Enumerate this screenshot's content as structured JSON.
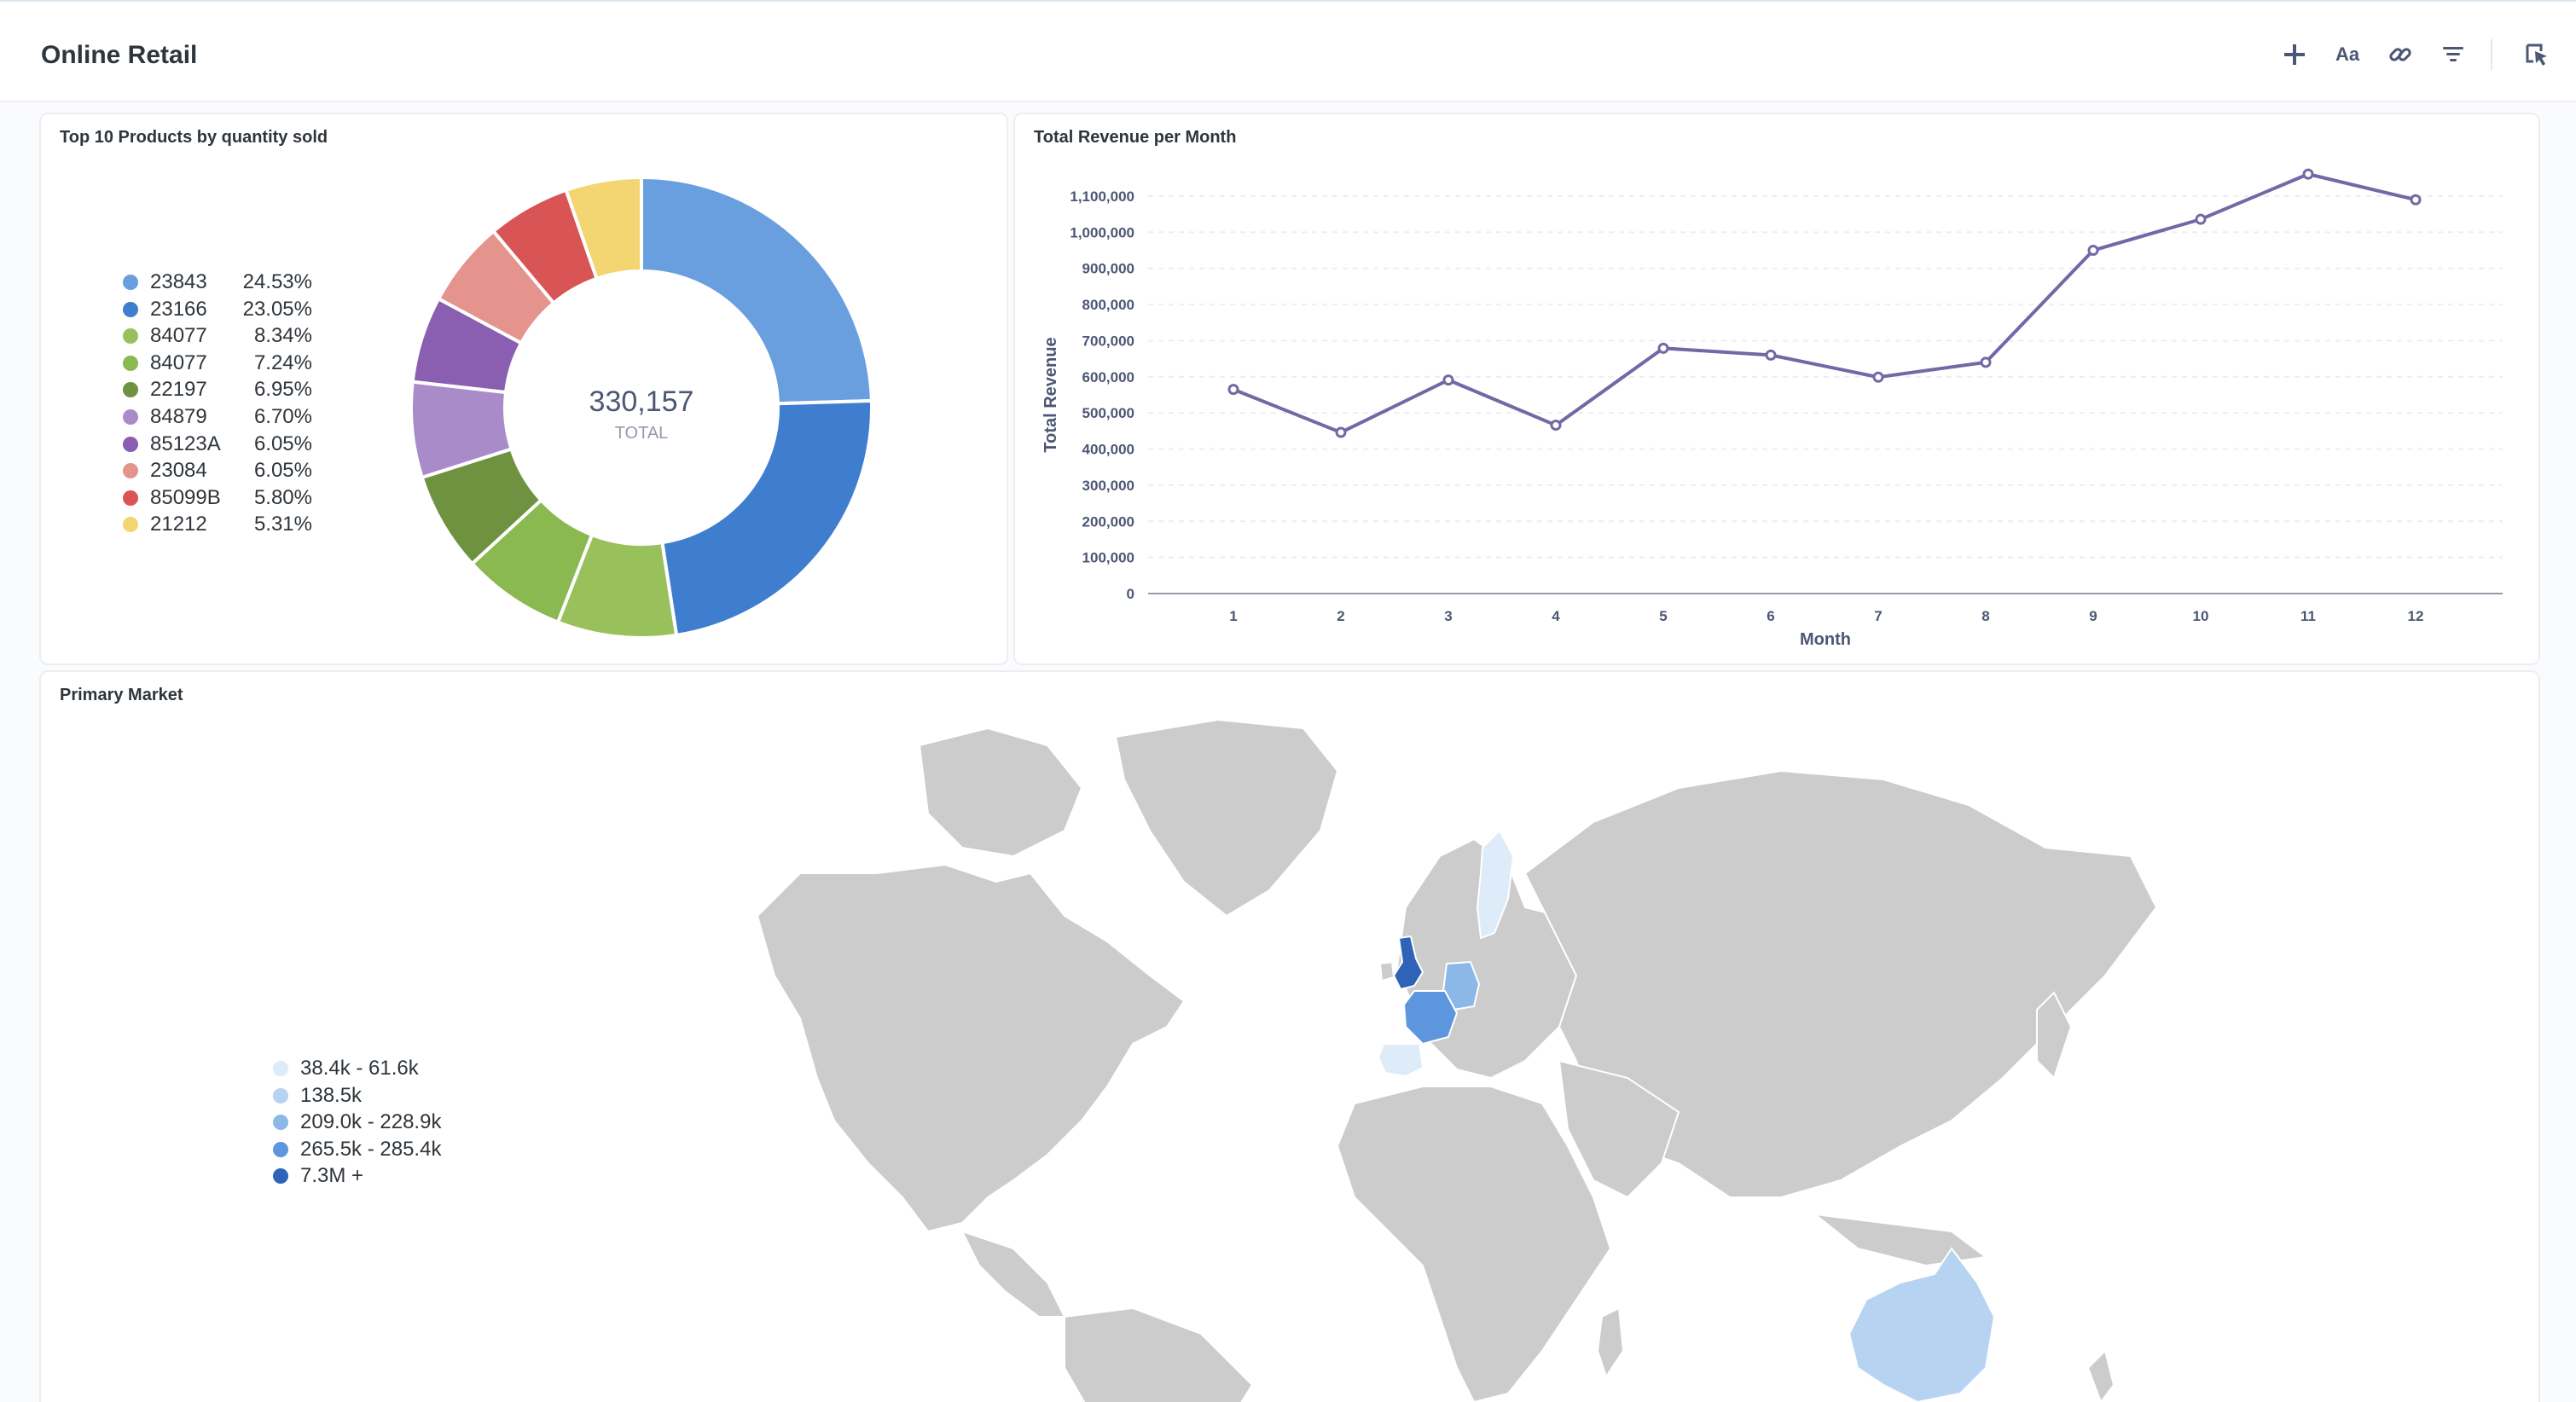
{
  "header": {
    "title": "Online Retail",
    "tools": [
      {
        "icon": "plus-icon",
        "label": ""
      },
      {
        "icon": "text-icon",
        "label": "Aa"
      },
      {
        "icon": "link-icon",
        "label": ""
      },
      {
        "icon": "filter-icon",
        "label": ""
      },
      {
        "icon": "click-behavior-icon",
        "label": ""
      }
    ]
  },
  "donut": {
    "title": "Top 10 Products by quantity sold",
    "total_value": "330,157",
    "total_label": "TOTAL"
  },
  "line": {
    "title": "Total Revenue per Month"
  },
  "map": {
    "title": "Primary Market",
    "legend": [
      {
        "label": "38.4k - 61.6k",
        "color": "#deebf9"
      },
      {
        "label": "138.5k",
        "color": "#b7d3f2"
      },
      {
        "label": "209.0k - 228.9k",
        "color": "#8cb8e8"
      },
      {
        "label": "265.5k - 285.4k",
        "color": "#5d96dc"
      },
      {
        "label": "7.3M +",
        "color": "#2f63b8"
      }
    ],
    "colors": {
      "land": "#cccccc",
      "border": "#ffffff"
    }
  },
  "chart_data": [
    {
      "type": "pie",
      "title": "Top 10 Products by quantity sold",
      "total": 330157,
      "categories": [
        "23843",
        "23166",
        "84077",
        "84077",
        "22197",
        "84879",
        "85123A",
        "23084",
        "85099B",
        "21212"
      ],
      "values": [
        24.53,
        23.05,
        8.34,
        7.24,
        6.95,
        6.7,
        6.05,
        6.05,
        5.8,
        5.31
      ],
      "labels": [
        "24.53%",
        "23.05%",
        "8.34%",
        "7.24%",
        "6.95%",
        "6.70%",
        "6.05%",
        "6.05%",
        "5.80%",
        "5.31%"
      ],
      "colors": [
        "#6a9fdf",
        "#3f7ecf",
        "#99c15b",
        "#8ab851",
        "#6e9240",
        "#a98bc9",
        "#8a5eb0",
        "#e4938d",
        "#d95555",
        "#f3d571"
      ],
      "legend_position": "left"
    },
    {
      "type": "line",
      "title": "Total Revenue per Month",
      "xlabel": "Month",
      "ylabel": "Total Revenue",
      "x": [
        1,
        2,
        3,
        4,
        5,
        6,
        7,
        8,
        9,
        10,
        11,
        12
      ],
      "y": [
        565000,
        446000,
        591000,
        466000,
        679000,
        660000,
        599000,
        640000,
        950000,
        1036000,
        1161000,
        1090000
      ],
      "ylim": [
        0,
        1100000
      ],
      "yticks": [
        "0",
        "100,000",
        "200,000",
        "300,000",
        "400,000",
        "500,000",
        "600,000",
        "700,000",
        "800,000",
        "900,000",
        "1,000,000",
        "1,100,000"
      ],
      "xticks": [
        "1",
        "2",
        "3",
        "4",
        "5",
        "6",
        "7",
        "8",
        "9",
        "10",
        "11",
        "12"
      ],
      "color": "#6f6aa5",
      "grid": true
    }
  ]
}
